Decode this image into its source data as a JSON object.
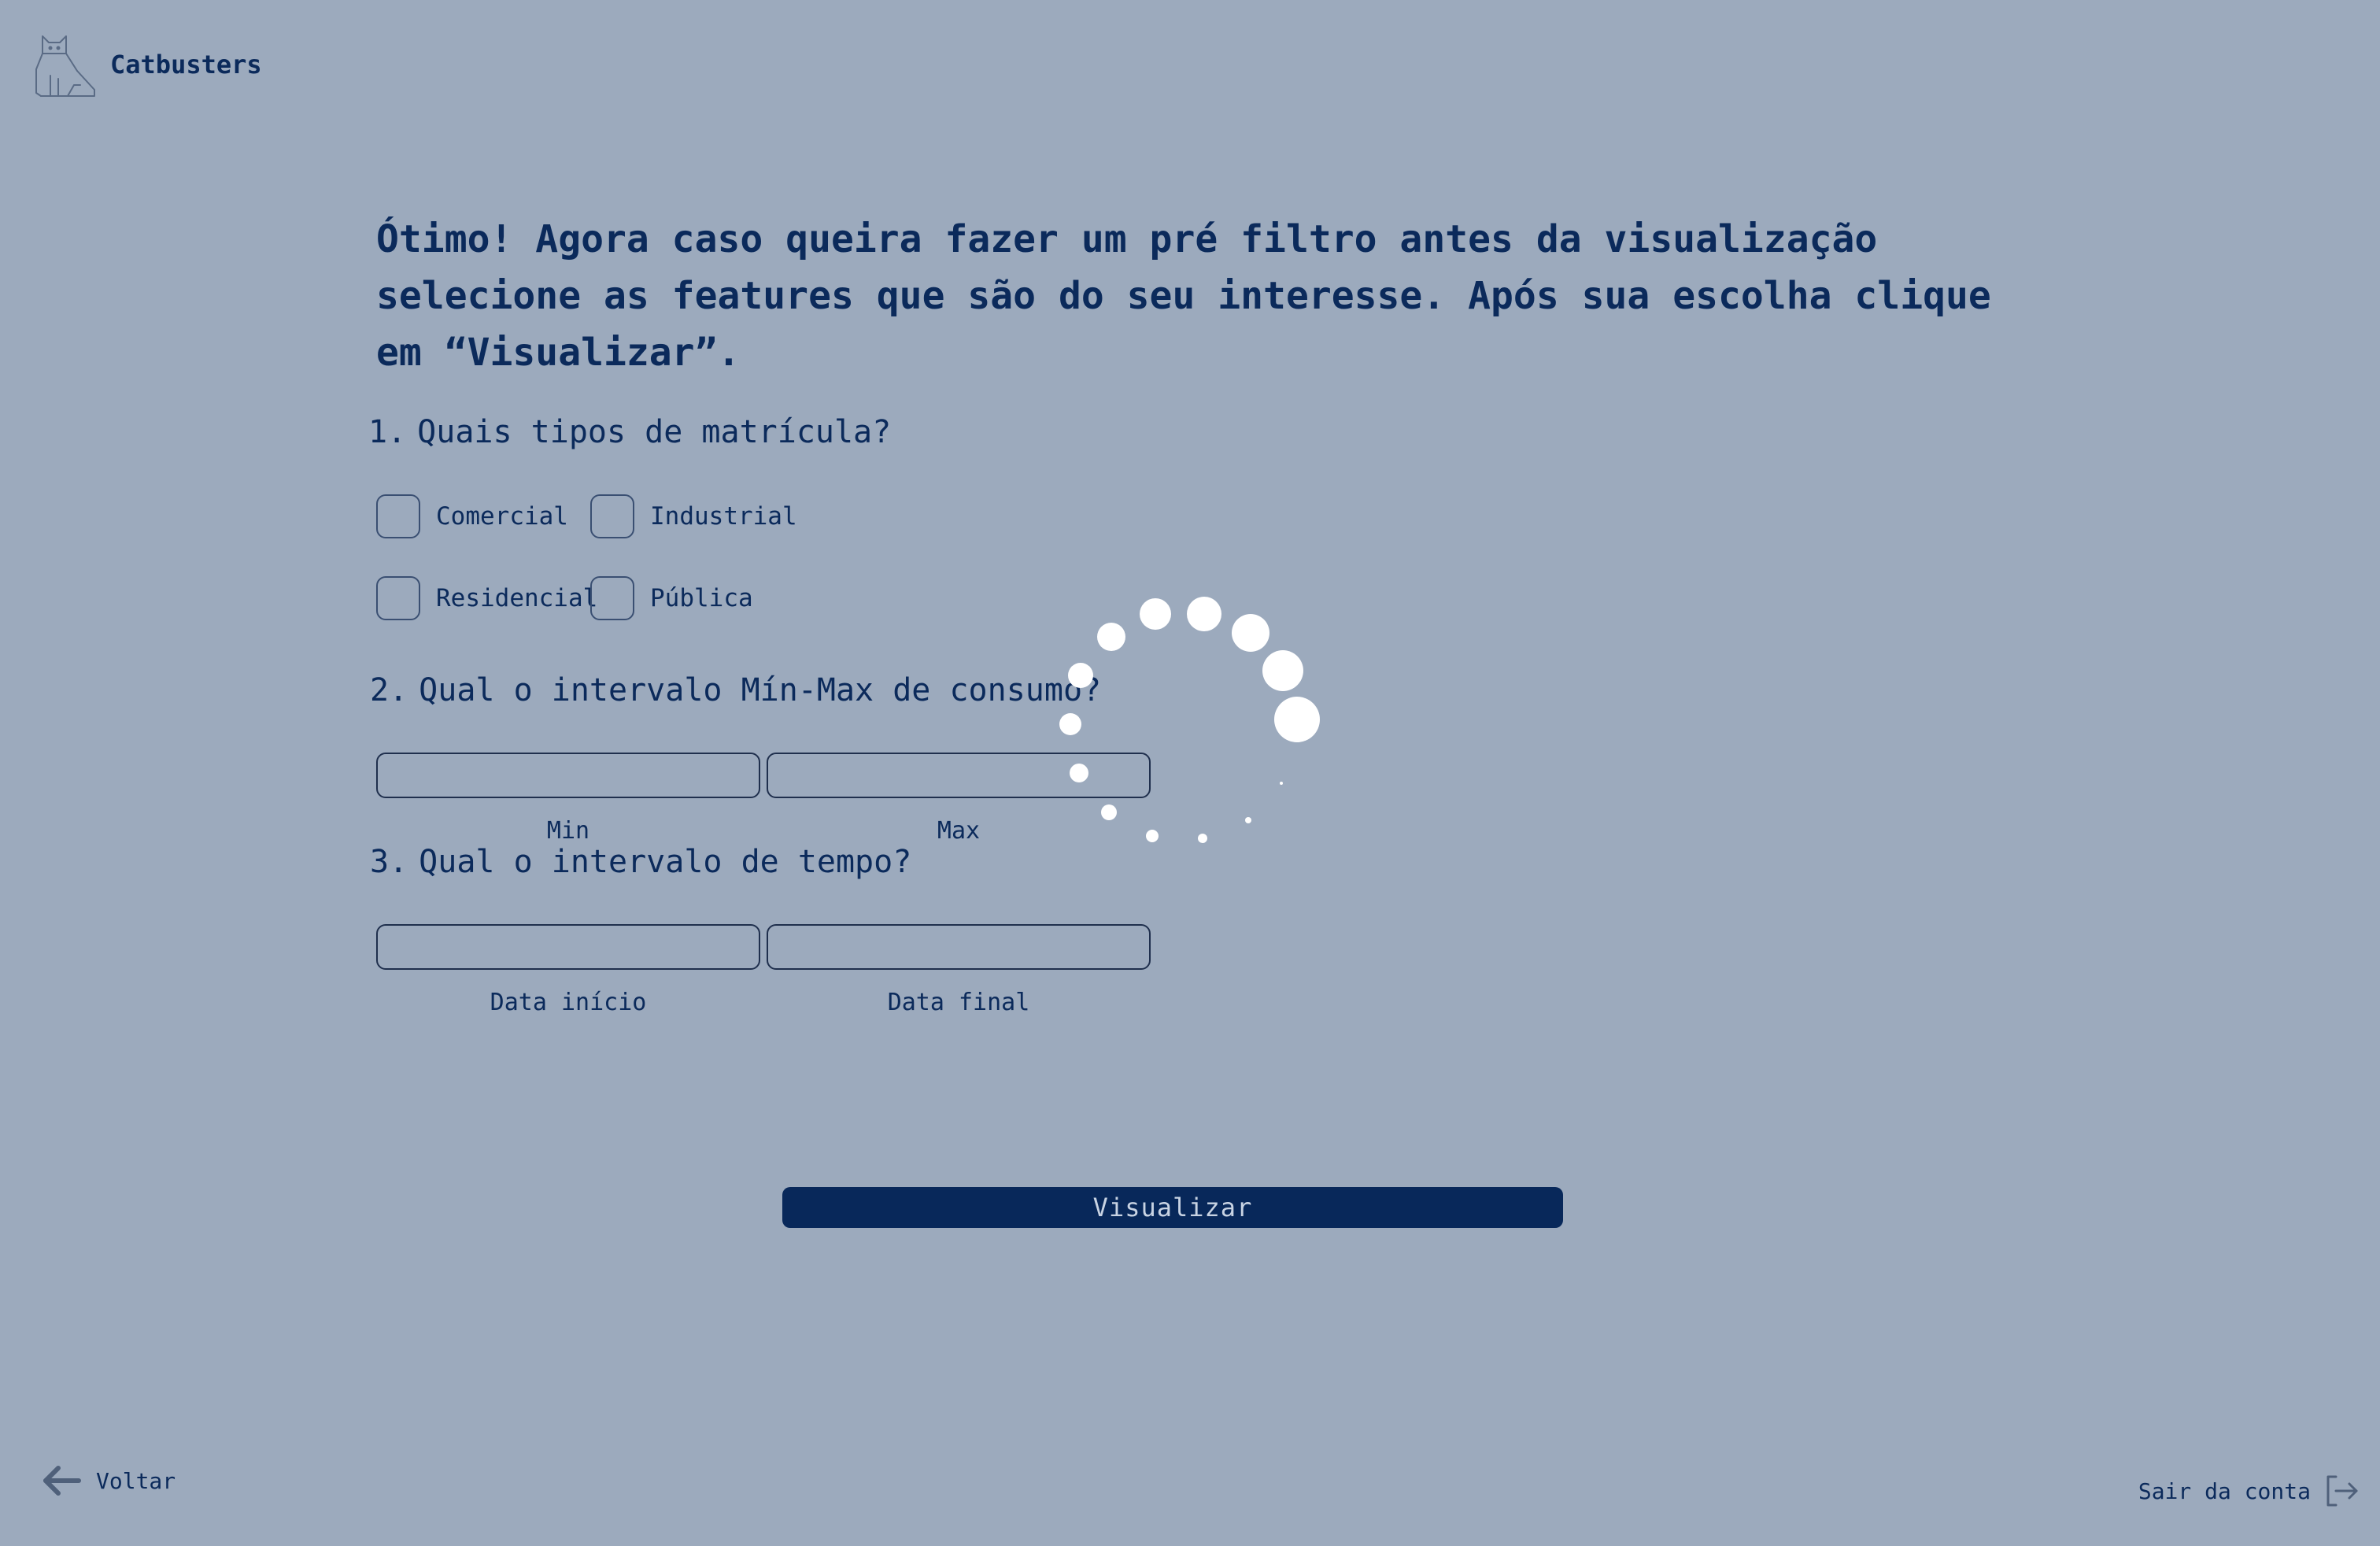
{
  "brand": {
    "name": "Catbusters",
    "logo_icon": "cat-icon"
  },
  "intro": {
    "text": "Ótimo! Agora caso queira fazer um pré filtro antes da visualização selecione as features que são do seu interesse. Após sua escolha clique em “Visualizar”."
  },
  "questions": [
    {
      "number": "1.",
      "text": "Quais tipos de matrícula?",
      "options": [
        {
          "label": "Comercial",
          "checked": false
        },
        {
          "label": "Industrial",
          "checked": false
        },
        {
          "label": "Residencial",
          "checked": false
        },
        {
          "label": "Pública",
          "checked": false
        }
      ]
    },
    {
      "number": "2.",
      "text": "Qual o intervalo Mín-Max de consumo?",
      "fields": [
        {
          "caption": "Min",
          "value": ""
        },
        {
          "caption": "Max",
          "value": ""
        }
      ]
    },
    {
      "number": "3.",
      "text": "Qual o intervalo de tempo?",
      "fields": [
        {
          "caption": "Data início",
          "value": ""
        },
        {
          "caption": "Data final",
          "value": ""
        }
      ]
    }
  ],
  "actions": {
    "visualizar_label": "Visualizar",
    "back_label": "Voltar",
    "back_icon": "arrow-left-icon",
    "logout_label": "Sair da conta",
    "logout_icon": "logout-icon"
  },
  "loading": {
    "icon": "loading-spinner-icon"
  },
  "colors": {
    "background": "#9caabd",
    "primary": "#0b2a5b",
    "button": "#08285a",
    "spinner": "#ffffff"
  }
}
